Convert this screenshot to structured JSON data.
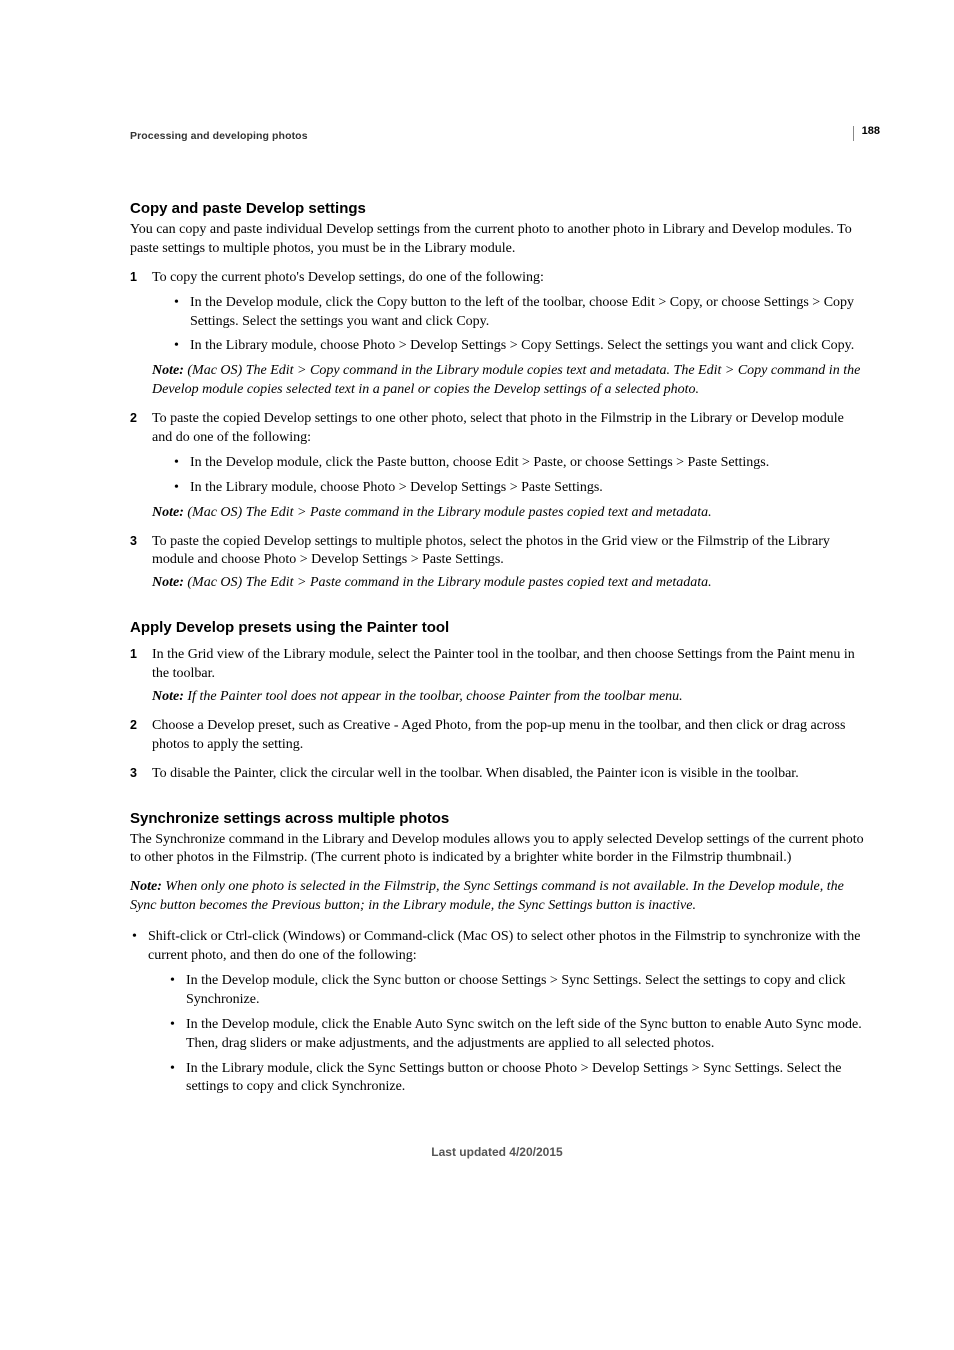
{
  "page_number": "188",
  "running_head": "Processing and developing photos",
  "sec1": {
    "heading": "Copy and paste Develop settings",
    "intro": "You can copy and paste individual Develop settings from the current photo to another photo in Library and Develop modules. To paste settings to multiple photos, you must be in the Library module.",
    "step1": {
      "text": "To copy the current photo's Develop settings, do one of the following:",
      "b1": "In the Develop module, click the Copy button to the left of the toolbar, choose Edit > Copy, or choose Settings > Copy Settings. Select the settings you want and click Copy.",
      "b2": "In the Library module, choose Photo > Develop Settings > Copy Settings. Select the settings you want and click Copy.",
      "note_label": "Note: ",
      "note": "(Mac OS) The Edit > Copy command in the Library module copies text and metadata. The Edit > Copy command in the Develop module copies selected text in a panel or copies the Develop settings of a selected photo."
    },
    "step2": {
      "text": "To paste the copied Develop settings to one other photo, select that photo in the Filmstrip in the Library or Develop module and do one of the following:",
      "b1": "In the Develop module, click the Paste button, choose Edit > Paste, or choose Settings > Paste Settings.",
      "b2": "In the Library module, choose Photo > Develop Settings > Paste Settings.",
      "note_label": "Note: ",
      "note": "(Mac OS) The Edit > Paste command in the Library module pastes copied text and metadata."
    },
    "step3": {
      "text": "To paste the copied Develop settings to multiple photos, select the photos in the Grid view or the Filmstrip of the Library module and choose Photo > Develop Settings > Paste Settings.",
      "note_label": "Note: ",
      "note": "(Mac OS) The Edit > Paste command in the Library module pastes copied text and metadata."
    }
  },
  "sec2": {
    "heading": "Apply Develop presets using the Painter tool",
    "step1": {
      "text": "In the Grid view of the Library module, select the Painter tool in the toolbar, and then choose Settings from the Paint menu in the toolbar.",
      "note_label": "Note: ",
      "note": "If the Painter tool does not appear in the toolbar, choose Painter from the toolbar menu."
    },
    "step2": {
      "text": "Choose a Develop preset, such as Creative - Aged Photo, from the pop-up menu in the toolbar, and then click or drag across photos to apply the setting."
    },
    "step3": {
      "text": "To disable the Painter, click the circular well in the toolbar. When disabled, the Painter icon is visible in the toolbar."
    }
  },
  "sec3": {
    "heading": "Synchronize settings across multiple photos",
    "intro": "The Synchronize command in the Library and Develop modules allows you to apply selected Develop settings of the current photo to other photos in the Filmstrip. (The current photo is indicated by a brighter white border in the Filmstrip thumbnail.)",
    "note_label": "Note: ",
    "note": "When only one photo is selected in the Filmstrip, the Sync Settings command is not available. In the Develop module, the Sync button becomes the Previous button; in the Library module, the Sync Settings button is inactive.",
    "b_main": "Shift-click or Ctrl-click (Windows) or Command-click (Mac OS) to select other photos in the Filmstrip to synchronize with the current photo, and then do one of the following:",
    "sub_b1": "In the Develop module, click the Sync button or choose Settings > Sync Settings. Select the settings to copy and click Synchronize.",
    "sub_b2": "In the Develop module, click the Enable Auto Sync switch on the left side of the Sync button to enable Auto Sync mode. Then, drag sliders or make adjustments, and the adjustments are applied to all selected photos.",
    "sub_b3": "In the Library module, click the Sync Settings button or choose Photo > Develop Settings > Sync Settings. Select the settings to copy and click Synchronize."
  },
  "footer": "Last updated 4/20/2015"
}
